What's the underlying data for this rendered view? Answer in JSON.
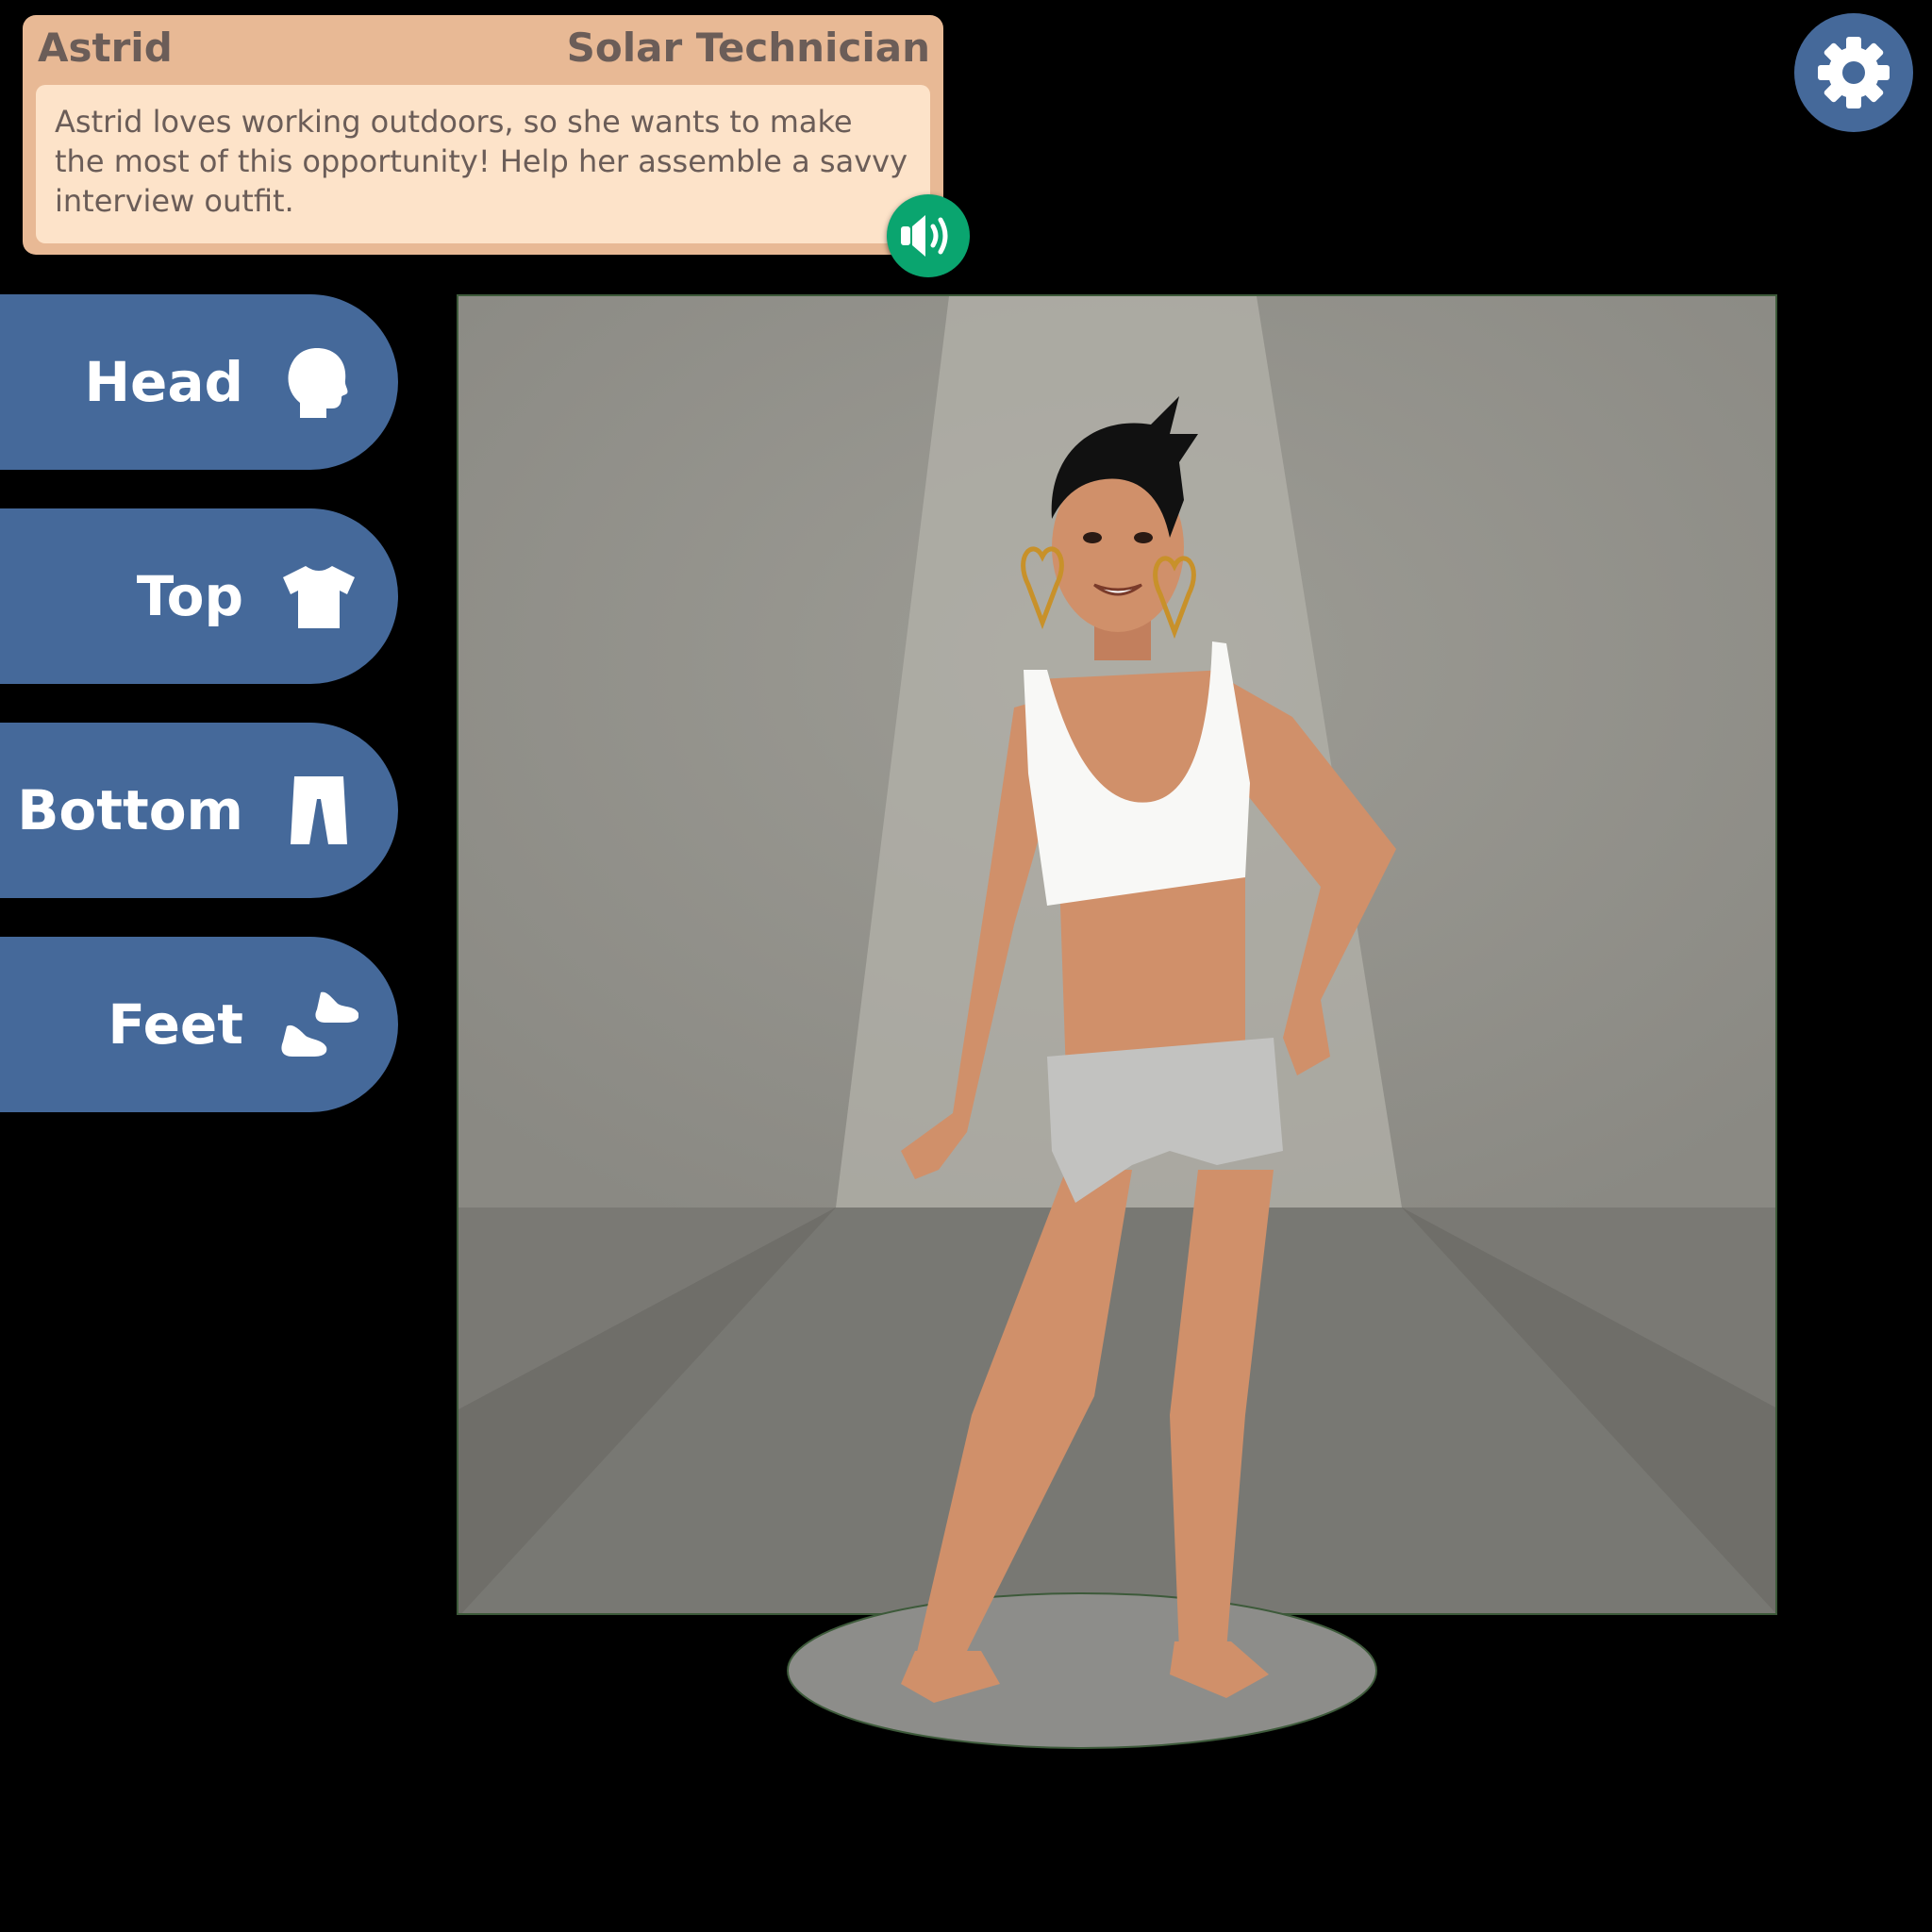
{
  "character": {
    "name": "Astrid",
    "job": "Solar Technician",
    "description": "Astrid loves working outdoors, so she wants to make the most of this opportunity! Help her assemble a savvy interview outfit."
  },
  "categories": [
    {
      "label": "Head",
      "icon": "head-icon"
    },
    {
      "label": "Top",
      "icon": "shirt-icon"
    },
    {
      "label": "Bottom",
      "icon": "pants-icon"
    },
    {
      "label": "Feet",
      "icon": "shoes-icon"
    }
  ],
  "controls": {
    "audio_icon": "speaker-icon",
    "settings_icon": "gear-icon"
  },
  "colors": {
    "tab_blue": "#45699a",
    "card_peach": "#e8b995",
    "card_body": "#fde3c9",
    "audio_green": "#0aa56f",
    "text_brown": "#6b5d58"
  }
}
